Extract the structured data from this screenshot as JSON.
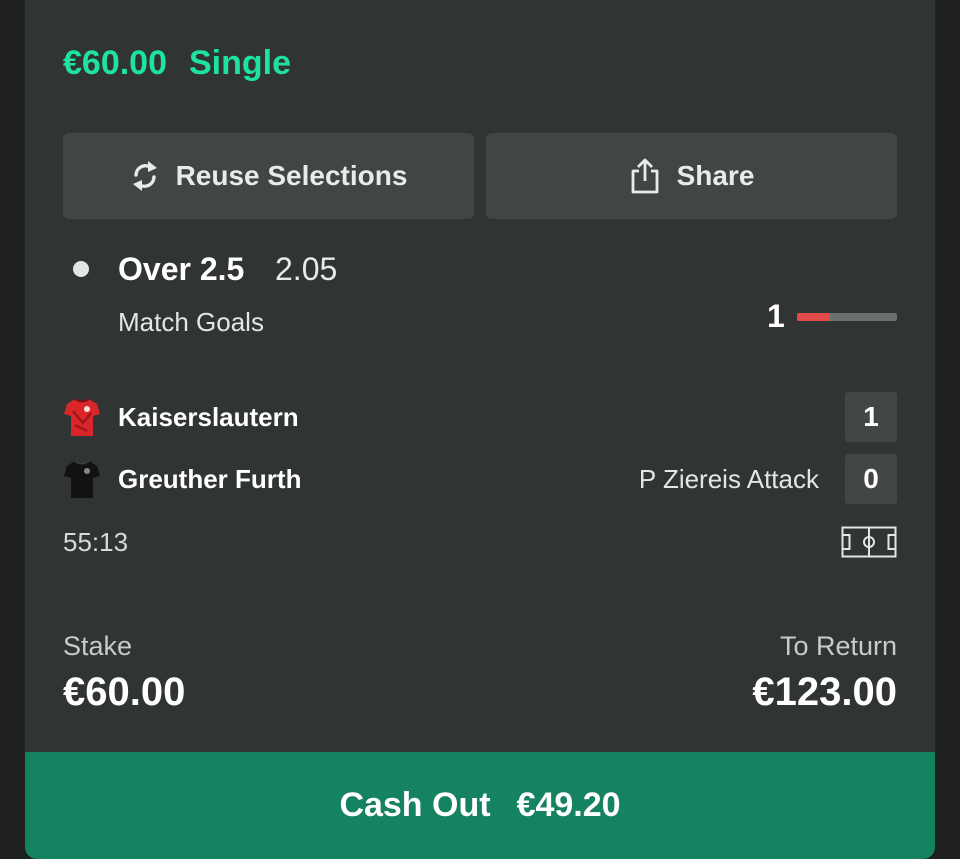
{
  "bet": {
    "stake_header": "€60.00",
    "type": "Single"
  },
  "actions": {
    "reuse_label": "Reuse Selections",
    "share_label": "Share"
  },
  "selection": {
    "name": "Over 2.5",
    "odds": "2.05",
    "market": "Match Goals",
    "goals_count": "1",
    "goals_progress_fraction": 0.33
  },
  "match": {
    "home": {
      "name": "Kaiserslautern",
      "score": "1",
      "event": ""
    },
    "away": {
      "name": "Greuther Furth",
      "score": "0",
      "event": "P Ziereis Attack"
    },
    "clock": "55:13"
  },
  "summary": {
    "stake_label": "Stake",
    "stake_value": "€60.00",
    "return_label": "To Return",
    "return_value": "€123.00"
  },
  "cashout": {
    "label": "Cash Out",
    "value": "€49.20"
  },
  "colors": {
    "accent": "#1ee3a0",
    "cashout_bg": "#158262",
    "progress_fill": "#e04a4a"
  },
  "icons": {
    "reuse": "refresh-icon",
    "share": "share-icon",
    "home_shirt": "red-shirt-icon",
    "away_shirt": "black-shirt-icon",
    "pitch": "pitch-icon"
  }
}
